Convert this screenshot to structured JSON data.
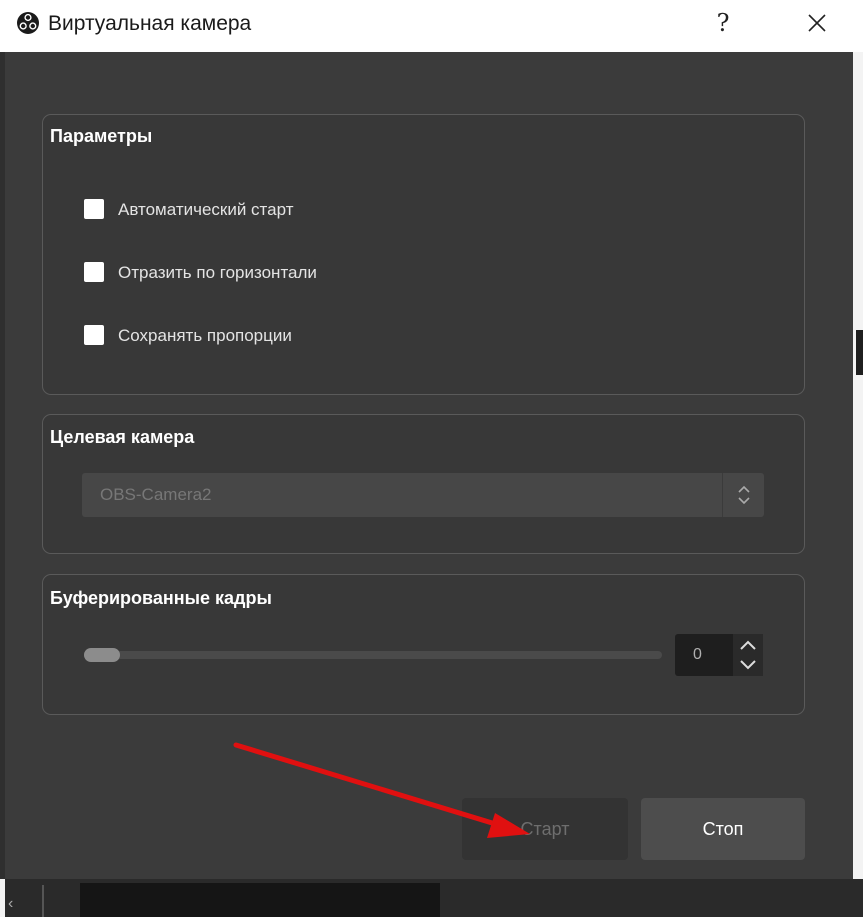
{
  "window": {
    "title": "Виртуальная камера",
    "help_label": "?",
    "logo_icon": "obs-logo-icon",
    "close_icon": "close-icon"
  },
  "groups": {
    "params": {
      "title": "Параметры",
      "checkboxes": [
        {
          "label": "Автоматический старт",
          "checked": false
        },
        {
          "label": "Отразить по горизонтали",
          "checked": false
        },
        {
          "label": "Сохранять пропорции",
          "checked": false
        }
      ]
    },
    "target_camera": {
      "title": "Целевая камера",
      "selected": "OBS-Camera2"
    },
    "buffered_frames": {
      "title": "Буферированные кадры",
      "value": "0"
    }
  },
  "buttons": {
    "start": "Старт",
    "stop": "Стоп"
  },
  "colors": {
    "annotation_arrow": "#e01010"
  }
}
